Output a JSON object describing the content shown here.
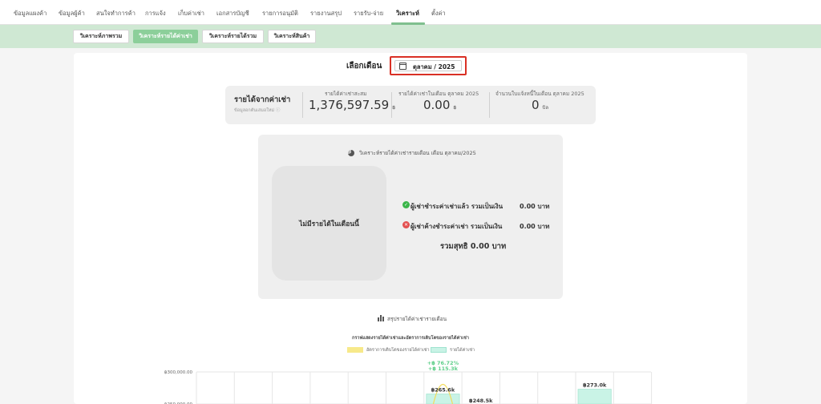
{
  "nav": {
    "items": [
      "ข้อมูลแผงค้า",
      "ข้อมูลผู้ค้า",
      "สนใจทำการค้า",
      "การแจ้ง",
      "เก็บค่าเช่า",
      "เอกสารบัญชี",
      "รายการอนุมัติ",
      "รายงานสรุป",
      "รายรับ-จ่าย",
      "วิเคราะห์",
      "ตั้งค่า"
    ],
    "active_index": 9
  },
  "subtabs": {
    "items": [
      "วิเคราะห์ภาพรวม",
      "วิเคราะห์รายได้ค่าเช่า",
      "วิเคราะห์รายได้รวม",
      "วิเคราะห์สินค้า"
    ],
    "active_index": 1
  },
  "month_picker": {
    "label": "เลือกเดือน",
    "value": "ตุลาคม / 2025"
  },
  "stats": {
    "title": "รายได้จากค่าเช่า",
    "subtitle": "ข้อมูลอกตันเสมอใหม่ ⓘ",
    "cumulative_label": "รายได้ค่าเช่าสะสม",
    "cumulative_value": "1,376,597.59",
    "cumulative_unit": "฿",
    "monthly_label": "รายได้ค่าเช่าในเดือน ตุลาคม 2025",
    "monthly_value": "0.00",
    "monthly_unit": "฿",
    "bills_label": "จำนวนใบแจ้งหนี้ในเดือน ตุลาคม 2025",
    "bills_value": "0",
    "bills_unit": "บิล"
  },
  "analysis": {
    "title": "วิเคราะห์รายได้ค่าเช่ารายเดือน เดือน ตุลาคม/2025",
    "no_income": "ไม่มีรายได้ในเดือนนี้",
    "paid_label": "ผู้เช่าชำระค่าเช่าแล้ว รวมเป็นเงิน",
    "paid_value": "0.00 บาท",
    "unpaid_label": "ผู้เช่าค้างชำระค่าเช่า รวมเป็นเงิน",
    "unpaid_value": "0.00 บาท",
    "total": "รวมสุทธิ 0.00 บาท"
  },
  "summary": {
    "title": "สรุปรายได้ค่าเช่ารายเดือน"
  },
  "chart_data": {
    "type": "bar",
    "title": "กราฟแสดงรายได้ค่าเช่าและอัตราการเติบโตของรายได้ค่าเช่า",
    "series": [
      {
        "name": "อัตราการเติบโตของรายได้ค่าเช่า",
        "color": "#f7e98a"
      },
      {
        "name": "รายได้ค่าเช่า",
        "color": "#c9f3e6"
      }
    ],
    "y_ticks": [
      "฿300,000.00",
      "฿250,000.00"
    ],
    "ylim": [
      0,
      300000
    ],
    "bars": [
      {
        "label": "฿265.6k",
        "value": 265600,
        "col": 6
      },
      {
        "label": "฿248.5k",
        "value": 248500,
        "col": 7
      },
      {
        "label": "฿273.0k",
        "value": 273000,
        "col": 10
      }
    ],
    "growth_annotations": [
      "+฿ 76.72%",
      "+฿ 115.3k"
    ]
  }
}
